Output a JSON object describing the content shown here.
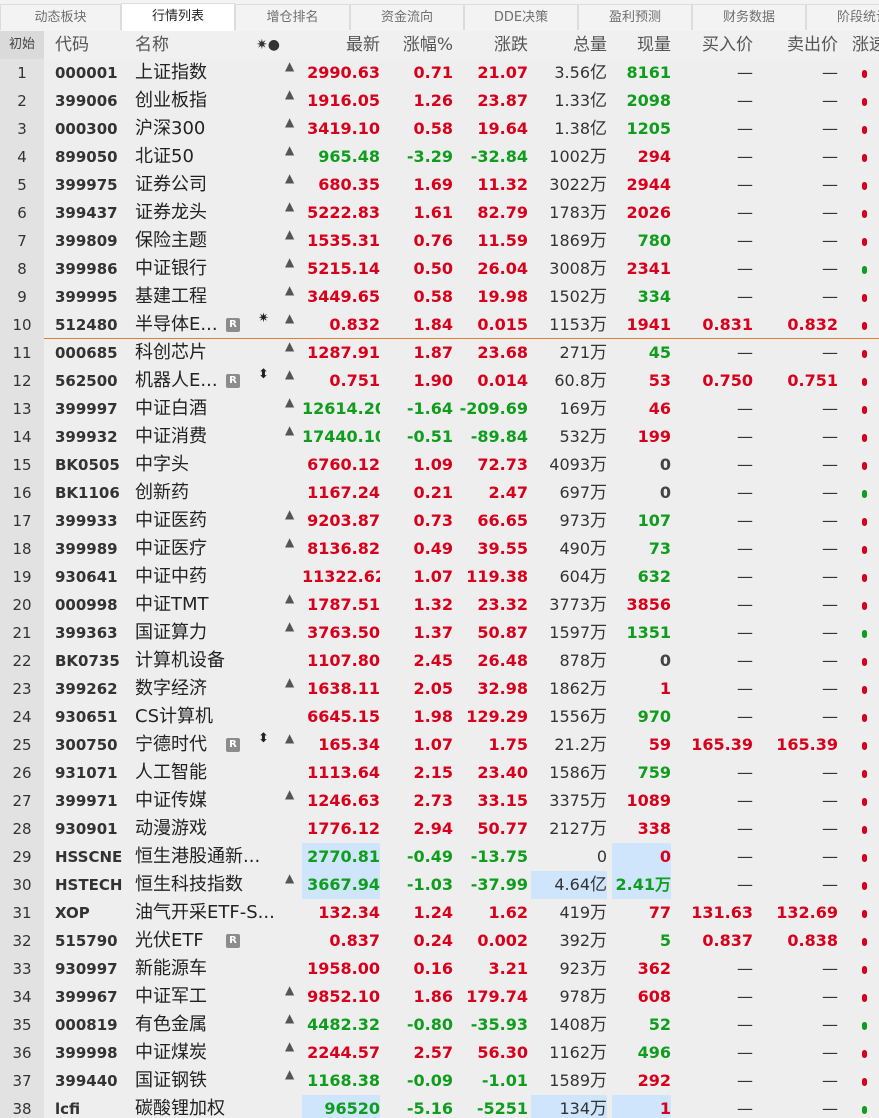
{
  "tabs": [
    "动态板块",
    "行情列表",
    "增仓排名",
    "资金流向",
    "DDE决策",
    "盈利预测",
    "财务数据",
    "阶段统计"
  ],
  "active_tab": 1,
  "columns": {
    "index": "初始",
    "code": "代码",
    "name": "名称",
    "flags": "✷●",
    "latest": "最新",
    "pct": "涨幅%",
    "change": "涨跌",
    "volume": "总量",
    "current": "现量",
    "buy": "买入价",
    "sell": "卖出价",
    "edge": "涨速"
  },
  "colors": {
    "up": "#d8001b",
    "down": "#0f9d1d",
    "highlight": "#cfe5fb",
    "separator": "#e87a2c"
  },
  "rows": [
    {
      "idx": "1",
      "code": "000001",
      "name": "上证指数",
      "bell": true,
      "latest": "2990.63",
      "pct": "0.71",
      "change": "21.07",
      "vol": "3.56",
      "unit": "亿",
      "cur": "8161",
      "cur_dir": "green",
      "buy": "—",
      "sell": "—",
      "dir": "up",
      "edge": "up"
    },
    {
      "idx": "2",
      "code": "399006",
      "name": "创业板指",
      "bell": true,
      "latest": "1916.05",
      "pct": "1.26",
      "change": "23.87",
      "vol": "1.33",
      "unit": "亿",
      "cur": "2098",
      "cur_dir": "green",
      "buy": "—",
      "sell": "—",
      "dir": "up",
      "edge": "up"
    },
    {
      "idx": "3",
      "code": "000300",
      "name": "沪深300",
      "bell": true,
      "latest": "3419.10",
      "pct": "0.58",
      "change": "19.64",
      "vol": "1.38",
      "unit": "亿",
      "cur": "1205",
      "cur_dir": "green",
      "buy": "—",
      "sell": "—",
      "dir": "up",
      "edge": "up"
    },
    {
      "idx": "4",
      "code": "899050",
      "name": "北证50",
      "bell": true,
      "latest": "965.48",
      "pct": "-3.29",
      "change": "-32.84",
      "vol": "1002",
      "unit": "万",
      "cur": "294",
      "cur_dir": "red",
      "buy": "—",
      "sell": "—",
      "dir": "down",
      "edge": "up"
    },
    {
      "idx": "5",
      "code": "399975",
      "name": "证券公司",
      "bell": true,
      "latest": "680.35",
      "pct": "1.69",
      "change": "11.32",
      "vol": "3022",
      "unit": "万",
      "cur": "2944",
      "cur_dir": "red",
      "buy": "—",
      "sell": "—",
      "dir": "up",
      "edge": "up"
    },
    {
      "idx": "6",
      "code": "399437",
      "name": "证券龙头",
      "bell": true,
      "latest": "5222.83",
      "pct": "1.61",
      "change": "82.79",
      "vol": "1783",
      "unit": "万",
      "cur": "2026",
      "cur_dir": "red",
      "buy": "—",
      "sell": "—",
      "dir": "up",
      "edge": "up"
    },
    {
      "idx": "7",
      "code": "399809",
      "name": "保险主题",
      "bell": true,
      "latest": "1535.31",
      "pct": "0.76",
      "change": "11.59",
      "vol": "1869",
      "unit": "万",
      "cur": "780",
      "cur_dir": "green",
      "buy": "—",
      "sell": "—",
      "dir": "up",
      "edge": "up"
    },
    {
      "idx": "8",
      "code": "399986",
      "name": "中证银行",
      "bell": true,
      "latest": "5215.14",
      "pct": "0.50",
      "change": "26.04",
      "vol": "3008",
      "unit": "万",
      "cur": "2341",
      "cur_dir": "red",
      "buy": "—",
      "sell": "—",
      "dir": "up",
      "edge": "down"
    },
    {
      "idx": "9",
      "code": "399995",
      "name": "基建工程",
      "bell": true,
      "latest": "3449.65",
      "pct": "0.58",
      "change": "19.98",
      "vol": "1502",
      "unit": "万",
      "cur": "334",
      "cur_dir": "green",
      "buy": "—",
      "sell": "—",
      "dir": "up",
      "edge": "up"
    },
    {
      "idx": "10",
      "code": "512480",
      "name": "半导体E...",
      "r": true,
      "star": "✷",
      "bell": true,
      "latest": "0.832",
      "pct": "1.84",
      "change": "0.015",
      "vol": "1153",
      "unit": "万",
      "cur": "1941",
      "cur_dir": "red",
      "buy": "0.831",
      "sell": "0.832",
      "dir": "up",
      "edge": "up",
      "sep": true
    },
    {
      "idx": "11",
      "code": "000685",
      "name": "科创芯片",
      "bell": true,
      "latest": "1287.91",
      "pct": "1.87",
      "change": "23.68",
      "vol": "271",
      "unit": "万",
      "cur": "45",
      "cur_dir": "green",
      "buy": "—",
      "sell": "—",
      "dir": "up",
      "edge": "up"
    },
    {
      "idx": "12",
      "code": "562500",
      "name": "机器人E...",
      "r": true,
      "star": "⬍",
      "bell": true,
      "latest": "0.751",
      "pct": "1.90",
      "change": "0.014",
      "vol": "60.8",
      "unit": "万",
      "cur": "53",
      "cur_dir": "red",
      "buy": "0.750",
      "sell": "0.751",
      "dir": "up",
      "edge": "up"
    },
    {
      "idx": "13",
      "code": "399997",
      "name": "中证白酒",
      "bell": true,
      "latest": "12614.20",
      "pct": "-1.64",
      "change": "-209.69",
      "vol": "169",
      "unit": "万",
      "cur": "46",
      "cur_dir": "red",
      "buy": "—",
      "sell": "—",
      "dir": "down",
      "edge": "up"
    },
    {
      "idx": "14",
      "code": "399932",
      "name": "中证消费",
      "bell": true,
      "latest": "17440.10",
      "pct": "-0.51",
      "change": "-89.84",
      "vol": "532",
      "unit": "万",
      "cur": "199",
      "cur_dir": "red",
      "buy": "—",
      "sell": "—",
      "dir": "down",
      "edge": "up"
    },
    {
      "idx": "15",
      "code": "BK0505",
      "name": "中字头",
      "bell": false,
      "latest": "6760.12",
      "pct": "1.09",
      "change": "72.73",
      "vol": "4093",
      "unit": "万",
      "cur": "0",
      "cur_dir": "gray",
      "buy": "—",
      "sell": "—",
      "dir": "up",
      "edge": "up"
    },
    {
      "idx": "16",
      "code": "BK1106",
      "name": "创新药",
      "bell": false,
      "latest": "1167.24",
      "pct": "0.21",
      "change": "2.47",
      "vol": "697",
      "unit": "万",
      "cur": "0",
      "cur_dir": "gray",
      "buy": "—",
      "sell": "—",
      "dir": "up",
      "edge": "down"
    },
    {
      "idx": "17",
      "code": "399933",
      "name": "中证医药",
      "bell": true,
      "latest": "9203.87",
      "pct": "0.73",
      "change": "66.65",
      "vol": "973",
      "unit": "万",
      "cur": "107",
      "cur_dir": "green",
      "buy": "—",
      "sell": "—",
      "dir": "up",
      "edge": "up"
    },
    {
      "idx": "18",
      "code": "399989",
      "name": "中证医疗",
      "bell": true,
      "latest": "8136.82",
      "pct": "0.49",
      "change": "39.55",
      "vol": "490",
      "unit": "万",
      "cur": "73",
      "cur_dir": "green",
      "buy": "—",
      "sell": "—",
      "dir": "up",
      "edge": "up"
    },
    {
      "idx": "19",
      "code": "930641",
      "name": "中证中药",
      "bell": false,
      "latest": "11322.62",
      "pct": "1.07",
      "change": "119.38",
      "vol": "604",
      "unit": "万",
      "cur": "632",
      "cur_dir": "green",
      "buy": "—",
      "sell": "—",
      "dir": "up",
      "edge": "up"
    },
    {
      "idx": "20",
      "code": "000998",
      "name": "中证TMT",
      "bell": true,
      "latest": "1787.51",
      "pct": "1.32",
      "change": "23.32",
      "vol": "3773",
      "unit": "万",
      "cur": "3856",
      "cur_dir": "red",
      "buy": "—",
      "sell": "—",
      "dir": "up",
      "edge": "up"
    },
    {
      "idx": "21",
      "code": "399363",
      "name": "国证算力",
      "bell": true,
      "latest": "3763.50",
      "pct": "1.37",
      "change": "50.87",
      "vol": "1597",
      "unit": "万",
      "cur": "1351",
      "cur_dir": "green",
      "buy": "—",
      "sell": "—",
      "dir": "up",
      "edge": "down"
    },
    {
      "idx": "22",
      "code": "BK0735",
      "name": "计算机设备",
      "bell": false,
      "latest": "1107.80",
      "pct": "2.45",
      "change": "26.48",
      "vol": "878",
      "unit": "万",
      "cur": "0",
      "cur_dir": "gray",
      "buy": "—",
      "sell": "—",
      "dir": "up",
      "edge": "up"
    },
    {
      "idx": "23",
      "code": "399262",
      "name": "数字经济",
      "bell": true,
      "latest": "1638.11",
      "pct": "2.05",
      "change": "32.98",
      "vol": "1862",
      "unit": "万",
      "cur": "1",
      "cur_dir": "red",
      "buy": "—",
      "sell": "—",
      "dir": "up",
      "edge": "up"
    },
    {
      "idx": "24",
      "code": "930651",
      "name": "CS计算机",
      "bell": false,
      "latest": "6645.15",
      "pct": "1.98",
      "change": "129.29",
      "vol": "1556",
      "unit": "万",
      "cur": "970",
      "cur_dir": "green",
      "buy": "—",
      "sell": "—",
      "dir": "up",
      "edge": "up"
    },
    {
      "idx": "25",
      "code": "300750",
      "name": "宁德时代",
      "r": true,
      "star": "⬍",
      "bell": true,
      "latest": "165.34",
      "pct": "1.07",
      "change": "1.75",
      "vol": "21.2",
      "unit": "万",
      "cur": "59",
      "cur_dir": "red",
      "buy": "165.39",
      "sell": "165.39",
      "dir": "up",
      "edge": "up"
    },
    {
      "idx": "26",
      "code": "931071",
      "name": "人工智能",
      "bell": false,
      "latest": "1113.64",
      "pct": "2.15",
      "change": "23.40",
      "vol": "1586",
      "unit": "万",
      "cur": "759",
      "cur_dir": "green",
      "buy": "—",
      "sell": "—",
      "dir": "up",
      "edge": "up"
    },
    {
      "idx": "27",
      "code": "399971",
      "name": "中证传媒",
      "bell": true,
      "latest": "1246.63",
      "pct": "2.73",
      "change": "33.15",
      "vol": "3375",
      "unit": "万",
      "cur": "1089",
      "cur_dir": "red",
      "buy": "—",
      "sell": "—",
      "dir": "up",
      "edge": "up"
    },
    {
      "idx": "28",
      "code": "930901",
      "name": "动漫游戏",
      "bell": false,
      "latest": "1776.12",
      "pct": "2.94",
      "change": "50.77",
      "vol": "2127",
      "unit": "万",
      "cur": "338",
      "cur_dir": "red",
      "buy": "—",
      "sell": "—",
      "dir": "up",
      "edge": "up"
    },
    {
      "idx": "29",
      "code": "HSSCNE",
      "name": "恒生港股通新...",
      "bell": false,
      "latest": "2770.81",
      "pct": "-0.49",
      "change": "-13.75",
      "vol": "0",
      "unit": "",
      "cur": "0",
      "cur_dir": "red",
      "buy": "—",
      "sell": "—",
      "dir": "down",
      "edge": "up",
      "hl_latest": true,
      "hl_cur": true
    },
    {
      "idx": "30",
      "code": "HSTECH",
      "name": "恒生科技指数",
      "bell": true,
      "latest": "3667.94",
      "pct": "-1.03",
      "change": "-37.99",
      "vol": "4.64",
      "unit": "亿",
      "cur": "2.41万",
      "cur_dir": "green",
      "buy": "—",
      "sell": "—",
      "dir": "down",
      "edge": "up",
      "hl_latest": true,
      "hl_vol": true,
      "hl_cur": true
    },
    {
      "idx": "31",
      "code": "XOP",
      "name": "油气开采ETF-S...",
      "bell": false,
      "latest": "132.34",
      "pct": "1.24",
      "change": "1.62",
      "vol": "419",
      "unit": "万",
      "cur": "77",
      "cur_dir": "red",
      "buy": "131.63",
      "sell": "132.69",
      "dir": "up",
      "edge": "up"
    },
    {
      "idx": "32",
      "code": "515790",
      "name": "光伏ETF",
      "r": true,
      "bell": false,
      "latest": "0.837",
      "pct": "0.24",
      "change": "0.002",
      "vol": "392",
      "unit": "万",
      "cur": "5",
      "cur_dir": "green",
      "buy": "0.837",
      "sell": "0.838",
      "dir": "up",
      "edge": "up"
    },
    {
      "idx": "33",
      "code": "930997",
      "name": "新能源车",
      "bell": false,
      "latest": "1958.00",
      "pct": "0.16",
      "change": "3.21",
      "vol": "923",
      "unit": "万",
      "cur": "362",
      "cur_dir": "red",
      "buy": "—",
      "sell": "—",
      "dir": "up",
      "edge": "up"
    },
    {
      "idx": "34",
      "code": "399967",
      "name": "中证军工",
      "bell": true,
      "latest": "9852.10",
      "pct": "1.86",
      "change": "179.74",
      "vol": "978",
      "unit": "万",
      "cur": "608",
      "cur_dir": "red",
      "buy": "—",
      "sell": "—",
      "dir": "up",
      "edge": "up"
    },
    {
      "idx": "35",
      "code": "000819",
      "name": "有色金属",
      "bell": true,
      "latest": "4482.32",
      "pct": "-0.80",
      "change": "-35.93",
      "vol": "1408",
      "unit": "万",
      "cur": "52",
      "cur_dir": "green",
      "buy": "—",
      "sell": "—",
      "dir": "down",
      "edge": "down"
    },
    {
      "idx": "36",
      "code": "399998",
      "name": "中证煤炭",
      "bell": true,
      "latest": "2244.57",
      "pct": "2.57",
      "change": "56.30",
      "vol": "1162",
      "unit": "万",
      "cur": "496",
      "cur_dir": "green",
      "buy": "—",
      "sell": "—",
      "dir": "up",
      "edge": "up"
    },
    {
      "idx": "37",
      "code": "399440",
      "name": "国证钢铁",
      "bell": true,
      "latest": "1168.38",
      "pct": "-0.09",
      "change": "-1.01",
      "vol": "1589",
      "unit": "万",
      "cur": "292",
      "cur_dir": "red",
      "buy": "—",
      "sell": "—",
      "dir": "down",
      "edge": "up"
    },
    {
      "idx": "38",
      "code": "lcfi",
      "name": "碳酸锂加权",
      "bell": false,
      "latest": "96520",
      "pct": "-5.16",
      "change": "-5251",
      "vol": "134",
      "unit": "万",
      "cur": "1",
      "cur_dir": "red",
      "buy": "—",
      "sell": "—",
      "dir": "down",
      "edge": "down",
      "hl_latest": true,
      "hl_vol": true,
      "hl_cur": true
    }
  ]
}
